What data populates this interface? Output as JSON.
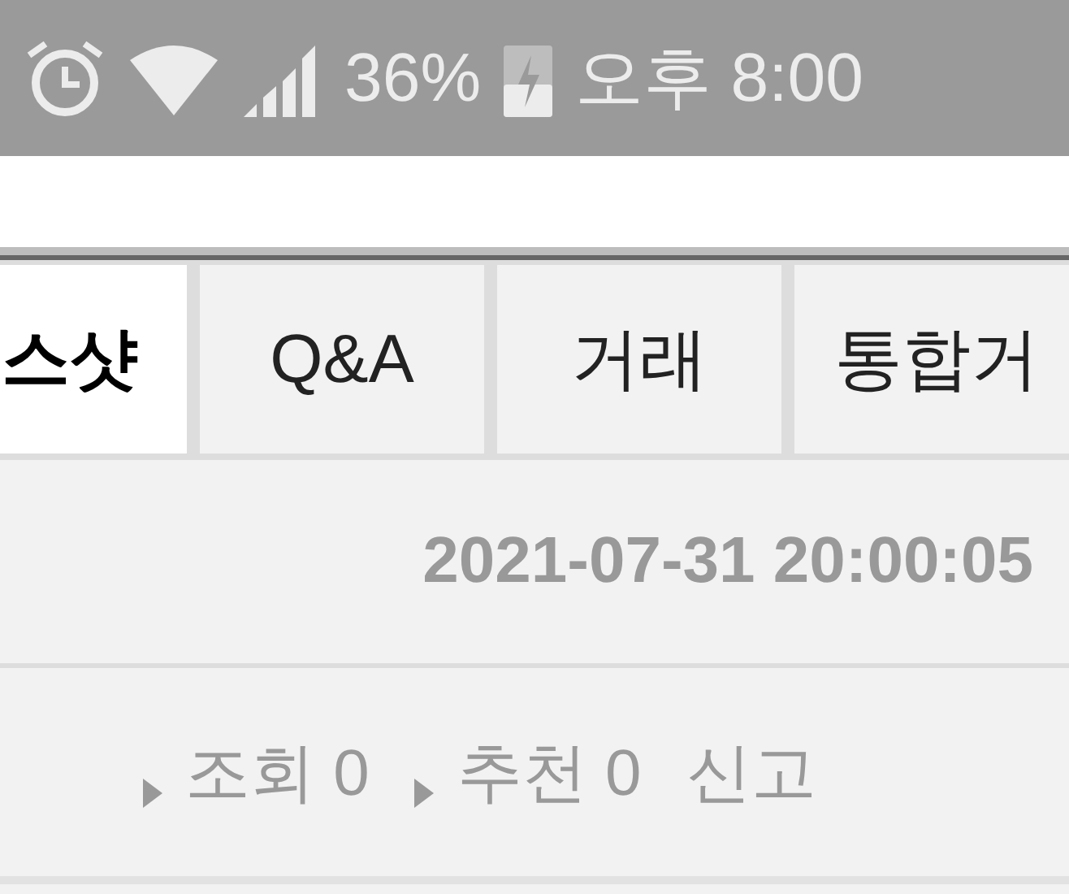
{
  "status_bar": {
    "battery": "36%",
    "time": "오후 8:00"
  },
  "tabs": [
    {
      "label": "스샷",
      "selected": true
    },
    {
      "label": "Q&A",
      "selected": false
    },
    {
      "label": "거래",
      "selected": false
    },
    {
      "label": "통합거",
      "selected": false
    }
  ],
  "post": {
    "date": "2021-07-31 20:00:05",
    "stats": [
      {
        "label": "조회 0"
      },
      {
        "label": "추천 0"
      }
    ],
    "report": "신고"
  }
}
